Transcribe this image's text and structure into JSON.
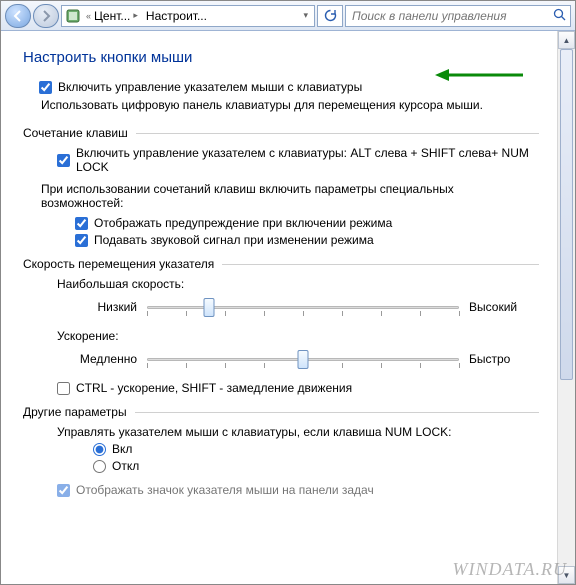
{
  "nav": {
    "crumb1": "Цент...",
    "crumb2": "Настроит...",
    "search_placeholder": "Поиск в панели управления"
  },
  "title": "Настроить кнопки мыши",
  "main_checkbox": {
    "label": "Включить управление указателем мыши с клавиатуры",
    "checked": true
  },
  "main_desc": "Использовать цифровую панель клавиатуры для перемещения курсора мыши.",
  "section_shortcut": {
    "title": "Сочетание клавиш",
    "enable": {
      "label": "Включить управление указателем с клавиатуры: ALT слева + SHIFT слева+ NUM LOCK",
      "checked": true
    },
    "desc": "При использовании сочетаний клавиш включить параметры специальных возможностей:",
    "warn": {
      "label": "Отображать предупреждение при включении режима",
      "checked": true
    },
    "sound": {
      "label": "Подавать звуковой сигнал при изменении режима",
      "checked": true
    }
  },
  "section_speed": {
    "title": "Скорость перемещения указателя",
    "max_label": "Наибольшая скорость:",
    "slider1": {
      "low": "Низкий",
      "high": "Высокий",
      "pos_pct": 20
    },
    "accel_label": "Ускорение:",
    "slider2": {
      "low": "Медленно",
      "high": "Быстро",
      "pos_pct": 50
    },
    "ctrl_shift": {
      "label": "CTRL - ускорение, SHIFT - замедление движения",
      "checked": false
    }
  },
  "section_other": {
    "title": "Другие параметры",
    "numlock_label": "Управлять указателем мыши с клавиатуры, если клавиша NUM LOCK:",
    "on": "Вкл",
    "off": "Откл",
    "selected": "on",
    "partial_row": "Отображать значок указателя мыши на панели задач"
  },
  "watermark": "WINDATA.RU"
}
